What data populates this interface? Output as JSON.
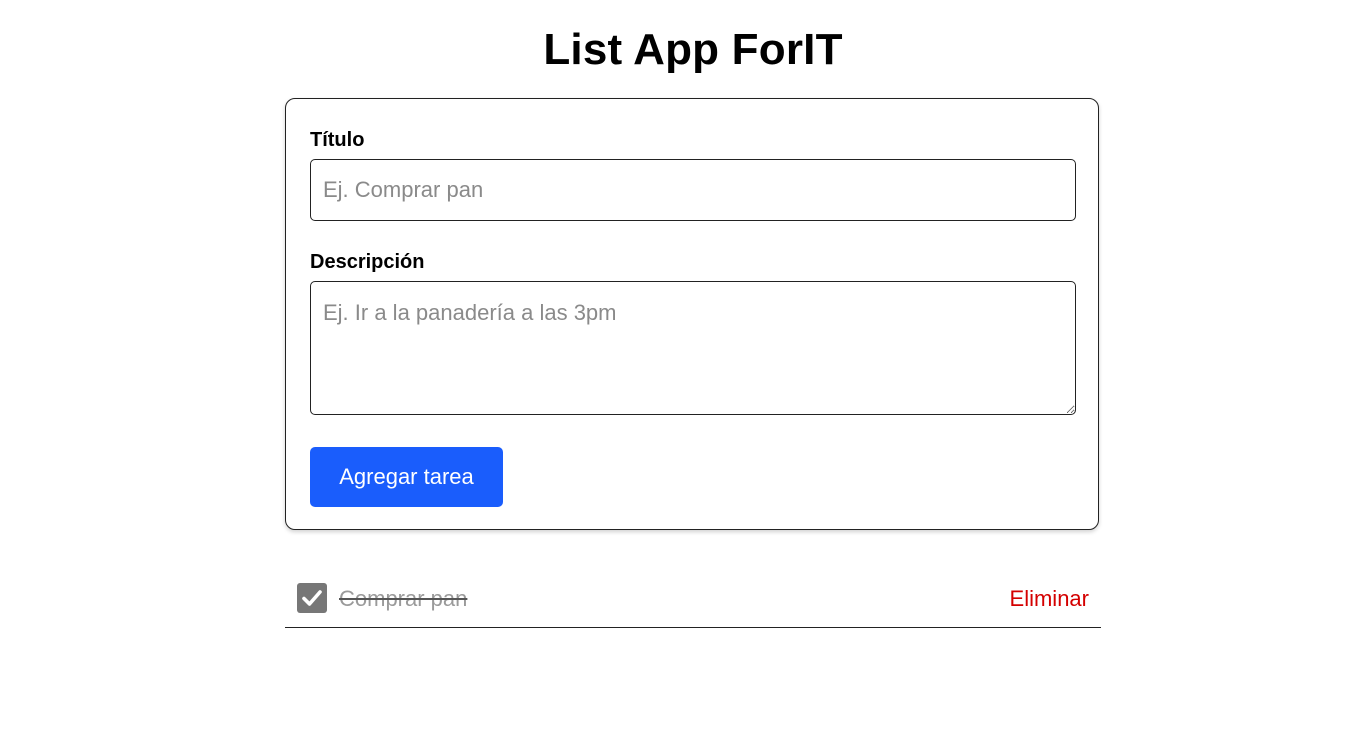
{
  "app": {
    "title": "List App ForIT"
  },
  "form": {
    "title_label": "Título",
    "title_value": "",
    "title_placeholder": "Ej. Comprar pan",
    "description_label": "Descripción",
    "description_value": "",
    "description_placeholder": "Ej. Ir a la panadería a las 3pm",
    "submit_label": "Agregar tarea"
  },
  "tasks": [
    {
      "title": "Comprar pan",
      "completed": true,
      "checkbox_icon": "checkmark-icon",
      "delete_label": "Eliminar"
    }
  ],
  "colors": {
    "primary_button": "#1a5dfc",
    "delete_text": "#d40000",
    "completed_text": "#9a9a9a",
    "checkbox_fill": "#777777"
  }
}
